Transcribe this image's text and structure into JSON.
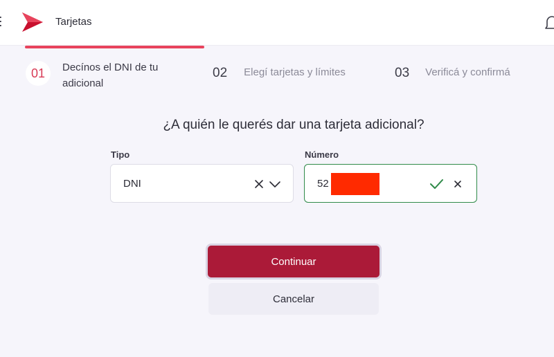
{
  "header": {
    "title": "Tarjetas",
    "menu_icon": "hamburger-menu-icon",
    "logo": "brand-logo",
    "notification_icon": "bell-icon"
  },
  "progress": {
    "fraction": 0.33
  },
  "steps": [
    {
      "number": "01",
      "label_line1": "Decínos el DNI de tu",
      "label_line2": "adicional",
      "active": true
    },
    {
      "number": "02",
      "label": "Elegí tarjetas y límites",
      "active": false
    },
    {
      "number": "03",
      "label": "Verificá y confirmá",
      "active": false
    }
  ],
  "form": {
    "question": "¿A quién le querés dar una tarjeta adicional?",
    "tipo": {
      "label": "Tipo",
      "value": "DNI"
    },
    "numero": {
      "label": "Número",
      "value": "52",
      "status": "valid"
    }
  },
  "actions": {
    "continue_label": "Continuar",
    "cancel_label": "Cancelar"
  },
  "colors": {
    "accent": "#e8435c",
    "primary_button": "#ab1a38",
    "valid": "#2f8a49"
  }
}
